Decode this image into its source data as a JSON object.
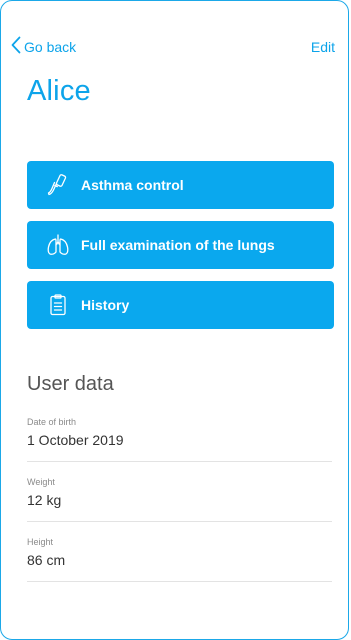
{
  "nav": {
    "back_label": "Go back",
    "edit_label": "Edit"
  },
  "profile": {
    "name": "Alice"
  },
  "actions": [
    {
      "label": "Asthma control",
      "icon": "inhaler-icon"
    },
    {
      "label": "Full examination of the lungs",
      "icon": "lungs-icon"
    },
    {
      "label": "History",
      "icon": "clipboard-icon"
    }
  ],
  "user_data": {
    "title": "User data",
    "fields": [
      {
        "label": "Date of birth",
        "value": "1 October 2019"
      },
      {
        "label": "Weight",
        "value": "12 kg"
      },
      {
        "label": "Height",
        "value": "86 cm"
      }
    ]
  },
  "colors": {
    "accent": "#0aa8ee",
    "frame_border": "#1ba8e8",
    "button_text": "#ffffff",
    "divider": "#e3e3e3"
  }
}
